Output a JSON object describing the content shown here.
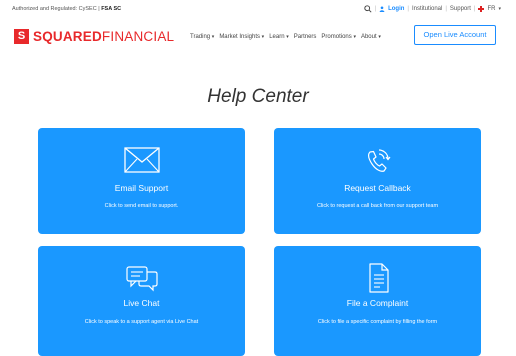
{
  "topbar": {
    "regulation_prefix": "Authorized and Regulated: CySEC |",
    "regulation_bold": "FSA SC",
    "login": "Login",
    "institutional": "Institutional",
    "support": "Support",
    "language": "FR"
  },
  "brand": {
    "name_bold": "SQUARED",
    "name_light": "FINANCIAL"
  },
  "nav": {
    "items": [
      "Trading",
      "Market Insights",
      "Learn",
      "Partners",
      "Promotions",
      "About"
    ],
    "cta": "Open Live Account"
  },
  "page": {
    "title": "Help Center"
  },
  "cards": [
    {
      "title": "Email Support",
      "description": "Click to send email to support.",
      "icon": "envelope-icon"
    },
    {
      "title": "Request Callback",
      "description": "Click to request a call back from our support team",
      "icon": "phone-callback-icon"
    },
    {
      "title": "Live Chat",
      "description": "Click to speak to a support agent via Live Chat",
      "icon": "chat-bubbles-icon"
    },
    {
      "title": "File a Complaint",
      "description": "Click to file a specific complaint by filling the form",
      "icon": "document-icon"
    }
  ],
  "colors": {
    "brand": "#e8292b",
    "accent": "#1a98ff",
    "link": "#1a8cff"
  }
}
